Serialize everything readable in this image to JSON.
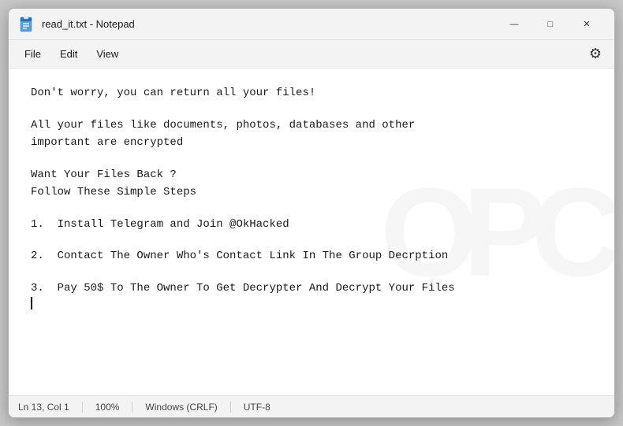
{
  "window": {
    "title": "read_it.txt - Notepad",
    "icon_label": "notepad-icon"
  },
  "controls": {
    "minimize": "—",
    "maximize": "□",
    "close": "✕"
  },
  "menu": {
    "items": [
      "File",
      "Edit",
      "View"
    ],
    "settings_icon": "⚙"
  },
  "content": {
    "lines": [
      "Don't worry, you can return all your files!",
      "",
      "All your files like documents, photos, databases and other",
      "important are encrypted",
      "",
      "Want Your Files Back ?",
      "Follow These Simple Steps",
      "",
      "1.  Install Telegram and Join @OkHacked",
      "",
      "2.  Contact The Owner Who's Contact Link In The Group Decrption",
      "",
      "3.  Pay 50$ To The Owner To Get Decrypter And Decrypt Your Files"
    ]
  },
  "status_bar": {
    "position": "Ln 13, Col 1",
    "zoom": "100%",
    "line_ending": "Windows (CRLF)",
    "encoding": "UTF-8"
  },
  "watermark": {
    "text": "OPC"
  }
}
